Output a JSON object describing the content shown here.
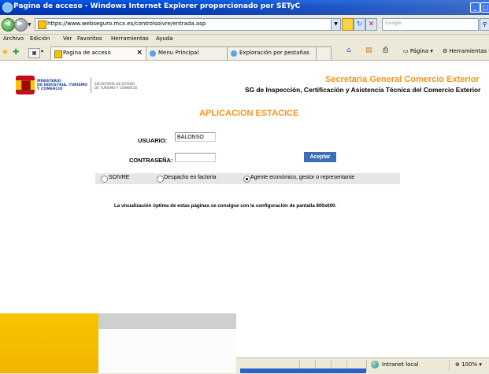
{
  "window": {
    "title": "Pagina de acceso - Windows Internet Explorer proporcionado por SETyC",
    "minimize_glyph": "_",
    "maximize_glyph": "□"
  },
  "address_bar": {
    "url": "https://www.webseguro.mcx.es/controlsoivre/entrada.asp",
    "search_placeholder": "Google"
  },
  "menu": [
    "Archivo",
    "Edición",
    "Ver",
    "Favoritos",
    "Herramientas",
    "Ayuda"
  ],
  "tabs": [
    {
      "label": "Pagina de acceso",
      "active": true
    },
    {
      "label": "Menu Principal",
      "active": false
    },
    {
      "label": "Exploración por pestañas",
      "active": false
    }
  ],
  "toolbar": {
    "page_label": "Página",
    "tools_label": "Herramientas"
  },
  "header": {
    "ministry_text": "MINISTERIO\nDE INDUSTRIA, TURISMO\nY COMERCIO",
    "secretaria_text": "SECRETARÍA DE ESTADO\nDE TURISMO Y COMERCIO",
    "sg_title": "Secretaria General Comercio Exterior",
    "sg_subtitle": "SG de Inspección, Certificación y Asistencia Técnica del Comercio Exterior"
  },
  "form": {
    "app_title": "APLICACION ESTACICE",
    "user_label": "USUARIO:",
    "user_value": "BALONSO",
    "password_label": "CONTRASEÑA:",
    "submit_label": "Aceptar",
    "radio_options": [
      {
        "label": "SOIVRE",
        "selected": false
      },
      {
        "label": "Despacho en factoría",
        "selected": false
      },
      {
        "label": "Agente económico, gestor o representante",
        "selected": true
      }
    ]
  },
  "note": "La visualización óptima de estas páginas se consigue con la configuración de pantalla 800x600.",
  "status_bar": {
    "zone": "Intranet local",
    "zoom": "100%"
  },
  "colors": {
    "accent_orange": "#f7941d",
    "button_blue": "#3c6fb8",
    "titlebar_blue": "#0040c8"
  }
}
